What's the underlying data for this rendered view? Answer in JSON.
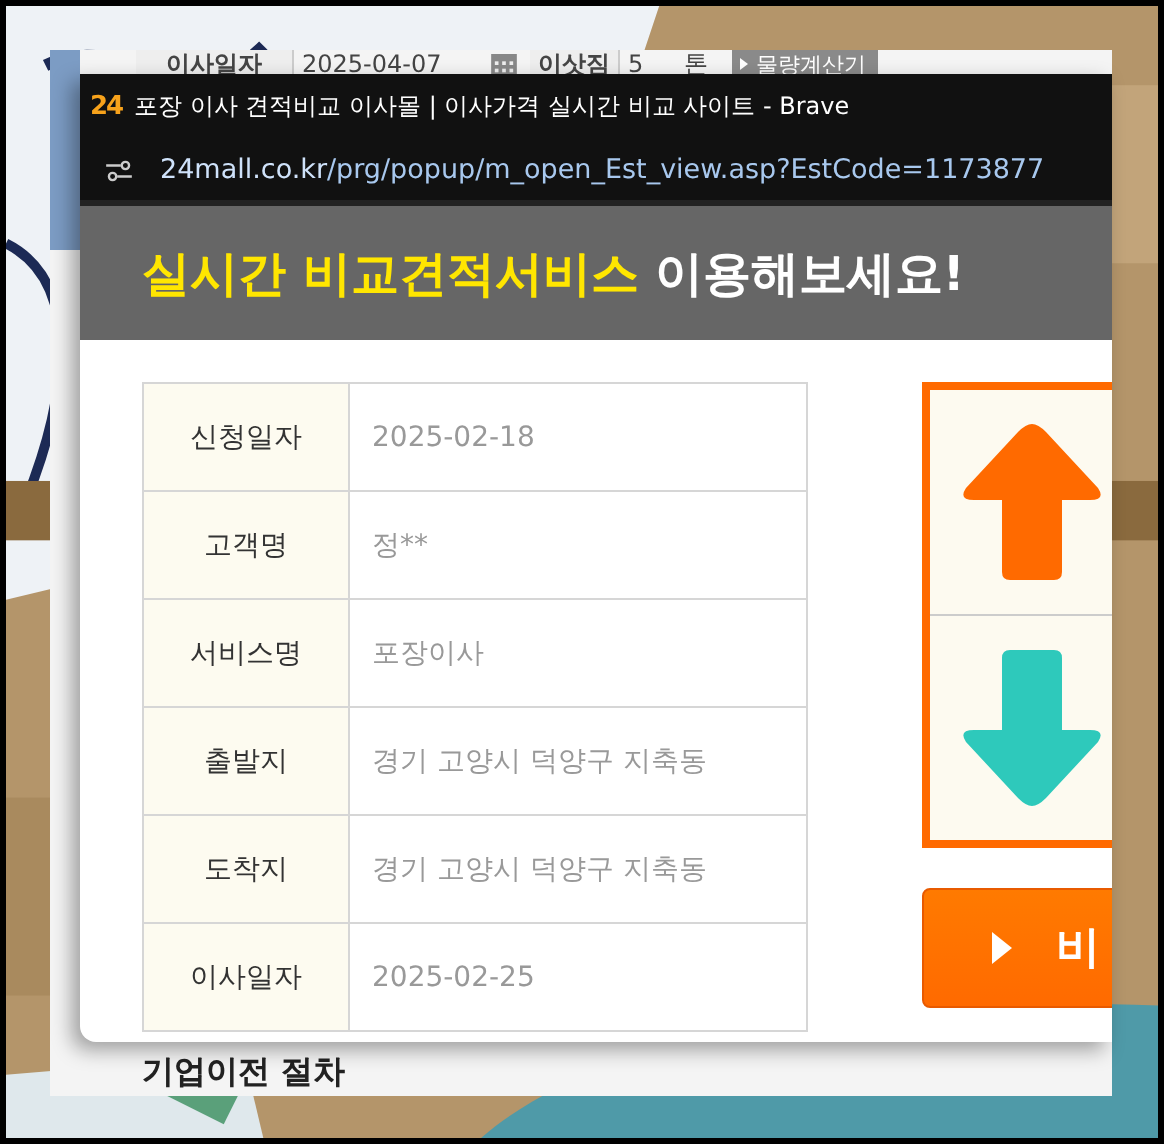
{
  "background_page": {
    "form_row": {
      "move_date_label": "이사일자",
      "move_date_value": "2025-04-07",
      "load_label": "이삿짐",
      "load_value": "5",
      "unit": "톤",
      "calculator_button": "물량계산기"
    },
    "section_heading": "기업이전 절차"
  },
  "browser_window": {
    "logo": "24",
    "title": "포장 이사 견적비교 이사몰 | 이사가격 실시간 비교 사이트 - Brave",
    "url_host": "24mall.co.kr",
    "url_path": "/prg/popup/m_open_Est_view.asp?EstCode=1173877"
  },
  "banner": {
    "highlight": "실시간 비교견적서비스",
    "rest": "이용해보세요!"
  },
  "details": [
    {
      "label": "신청일자",
      "value": "2025-02-18"
    },
    {
      "label": "고객명",
      "value": "정**"
    },
    {
      "label": "서비스명",
      "value": "포장이사"
    },
    {
      "label": "출발지",
      "value": "경기 고양시 덕양구 지축동"
    },
    {
      "label": "도착지",
      "value": "경기 고양시 덕양구 지축동"
    },
    {
      "label": "이사일자",
      "value": "2025-02-25"
    }
  ],
  "compare_button": "비"
}
